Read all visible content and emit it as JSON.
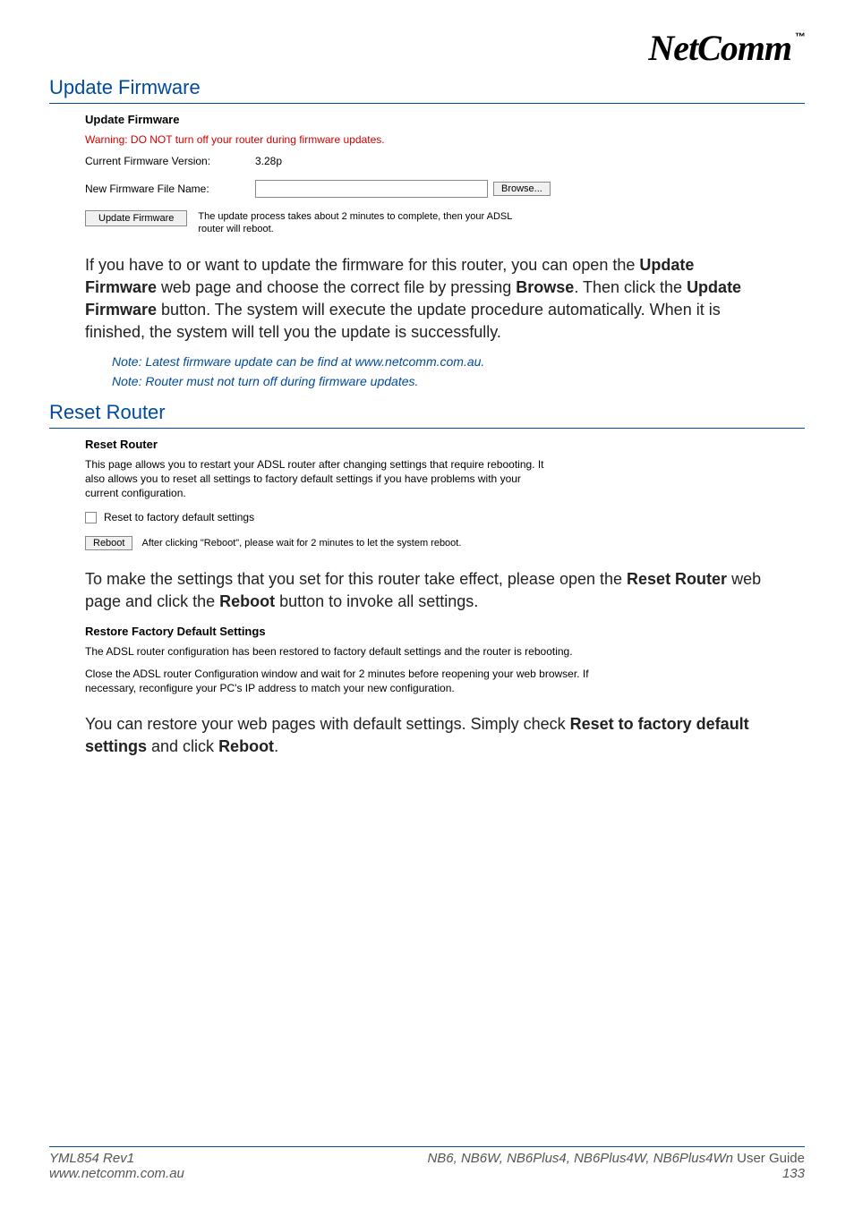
{
  "logo": {
    "text": "NetComm",
    "tm": "™"
  },
  "update_firmware": {
    "section_title": "Update Firmware",
    "panel_title": "Update Firmware",
    "warning": "Warning: DO NOT turn off your router during firmware updates.",
    "current_version_label": "Current Firmware Version:",
    "current_version_value": "3.28p",
    "new_file_label": "New Firmware File Name:",
    "new_file_value": "",
    "browse_btn": "Browse...",
    "update_btn": "Update Firmware",
    "update_hint": "The update process takes about 2 minutes to complete, then your ADSL router will reboot.",
    "body_before_bold1": "If you have to or want to update the firmware for this router, you can open the ",
    "bold1": "Update Firmware",
    "body_mid1": " web page and choose the correct file by pressing ",
    "bold2": "Browse",
    "body_mid2": ". Then click the ",
    "bold3": "Update Firmware",
    "body_after": " button. The system will execute the update procedure automatically. When it is finished, the system will tell you the update is successfully.",
    "note1": "Note: Latest firmware update can be find at www.netcomm.com.au.",
    "note2": "Note: Router must not turn off during firmware updates."
  },
  "reset_router": {
    "section_title": "Reset Router",
    "panel_title": "Reset Router",
    "desc": "This page allows you to restart your ADSL router after changing settings that require rebooting. It also allows you to reset all settings to factory default settings if you have problems with your current configuration.",
    "checkbox_label": "Reset to factory default settings",
    "reboot_btn": "Reboot",
    "reboot_hint": "After clicking \"Reboot\", please wait for 2 minutes to let the system reboot.",
    "body_before_bold1": "To make the settings that you set for this router take effect, please open the ",
    "bold1": "Reset Router",
    "body_mid1": " web page and click the ",
    "bold2": "Reboot",
    "body_after": " button to invoke all settings."
  },
  "restore": {
    "panel_title": "Restore Factory Default Settings",
    "line1": "The ADSL router configuration has been restored to factory default settings and the router is rebooting.",
    "line2": "Close the ADSL router Configuration window and wait for 2 minutes before reopening your web browser. If necessary, reconfigure your PC's IP address to match your new configuration.",
    "body_before_bold1": "You can restore your web pages with default settings. Simply check ",
    "bold1": "Reset to factory default settings",
    "body_mid1": " and click ",
    "bold2": "Reboot",
    "body_after": "."
  },
  "footer": {
    "left_line1": "YML854 Rev1",
    "left_line2": "www.netcomm.com.au",
    "right_models": "NB6, NB6W, NB6Plus4, NB6Plus4W, NB6Plus4Wn ",
    "right_guide": "User Guide",
    "right_page": "133"
  }
}
